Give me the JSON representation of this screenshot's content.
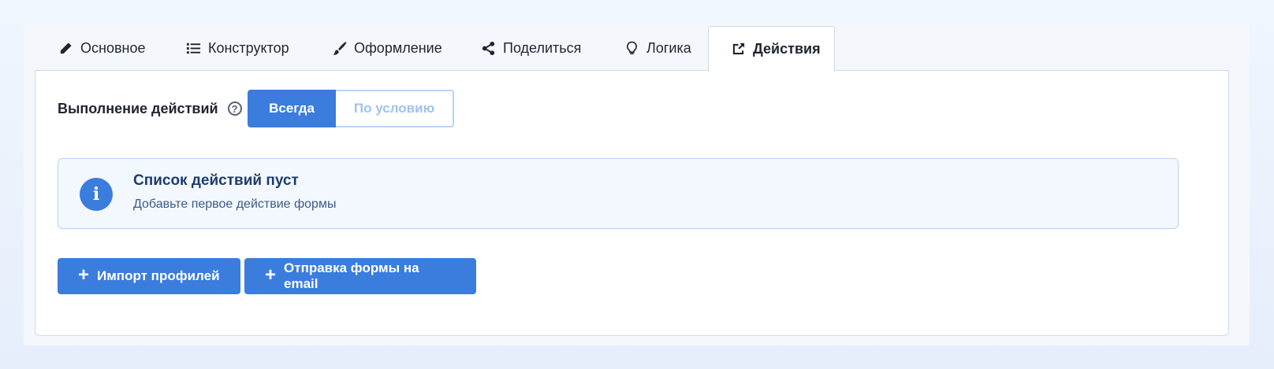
{
  "tabs": [
    {
      "label": "Основное",
      "icon": "pencil-icon"
    },
    {
      "label": "Конструктор",
      "icon": "list-icon"
    },
    {
      "label": "Оформление",
      "icon": "brush-icon"
    },
    {
      "label": "Поделиться",
      "icon": "share-icon"
    },
    {
      "label": "Логика",
      "icon": "lightbulb-icon"
    },
    {
      "label": "Действия",
      "icon": "external-share-icon",
      "active": true
    }
  ],
  "execution": {
    "label": "Выполнение действий",
    "help_glyph": "?",
    "options": [
      "Всегда",
      "По условию"
    ],
    "selected": "Всегда"
  },
  "alert": {
    "title": "Список действий пуст",
    "description": "Добавьте первое действие формы",
    "icon_glyph": "i"
  },
  "buttons": [
    {
      "label": "Импорт профилей",
      "icon": "plus-icon"
    },
    {
      "label": "Отправка формы на email",
      "icon": "plus-icon"
    }
  ],
  "colors": {
    "accent": "#3b7ddd",
    "alert_bg": "#f3f8fe",
    "alert_title": "#1d3b6e"
  }
}
